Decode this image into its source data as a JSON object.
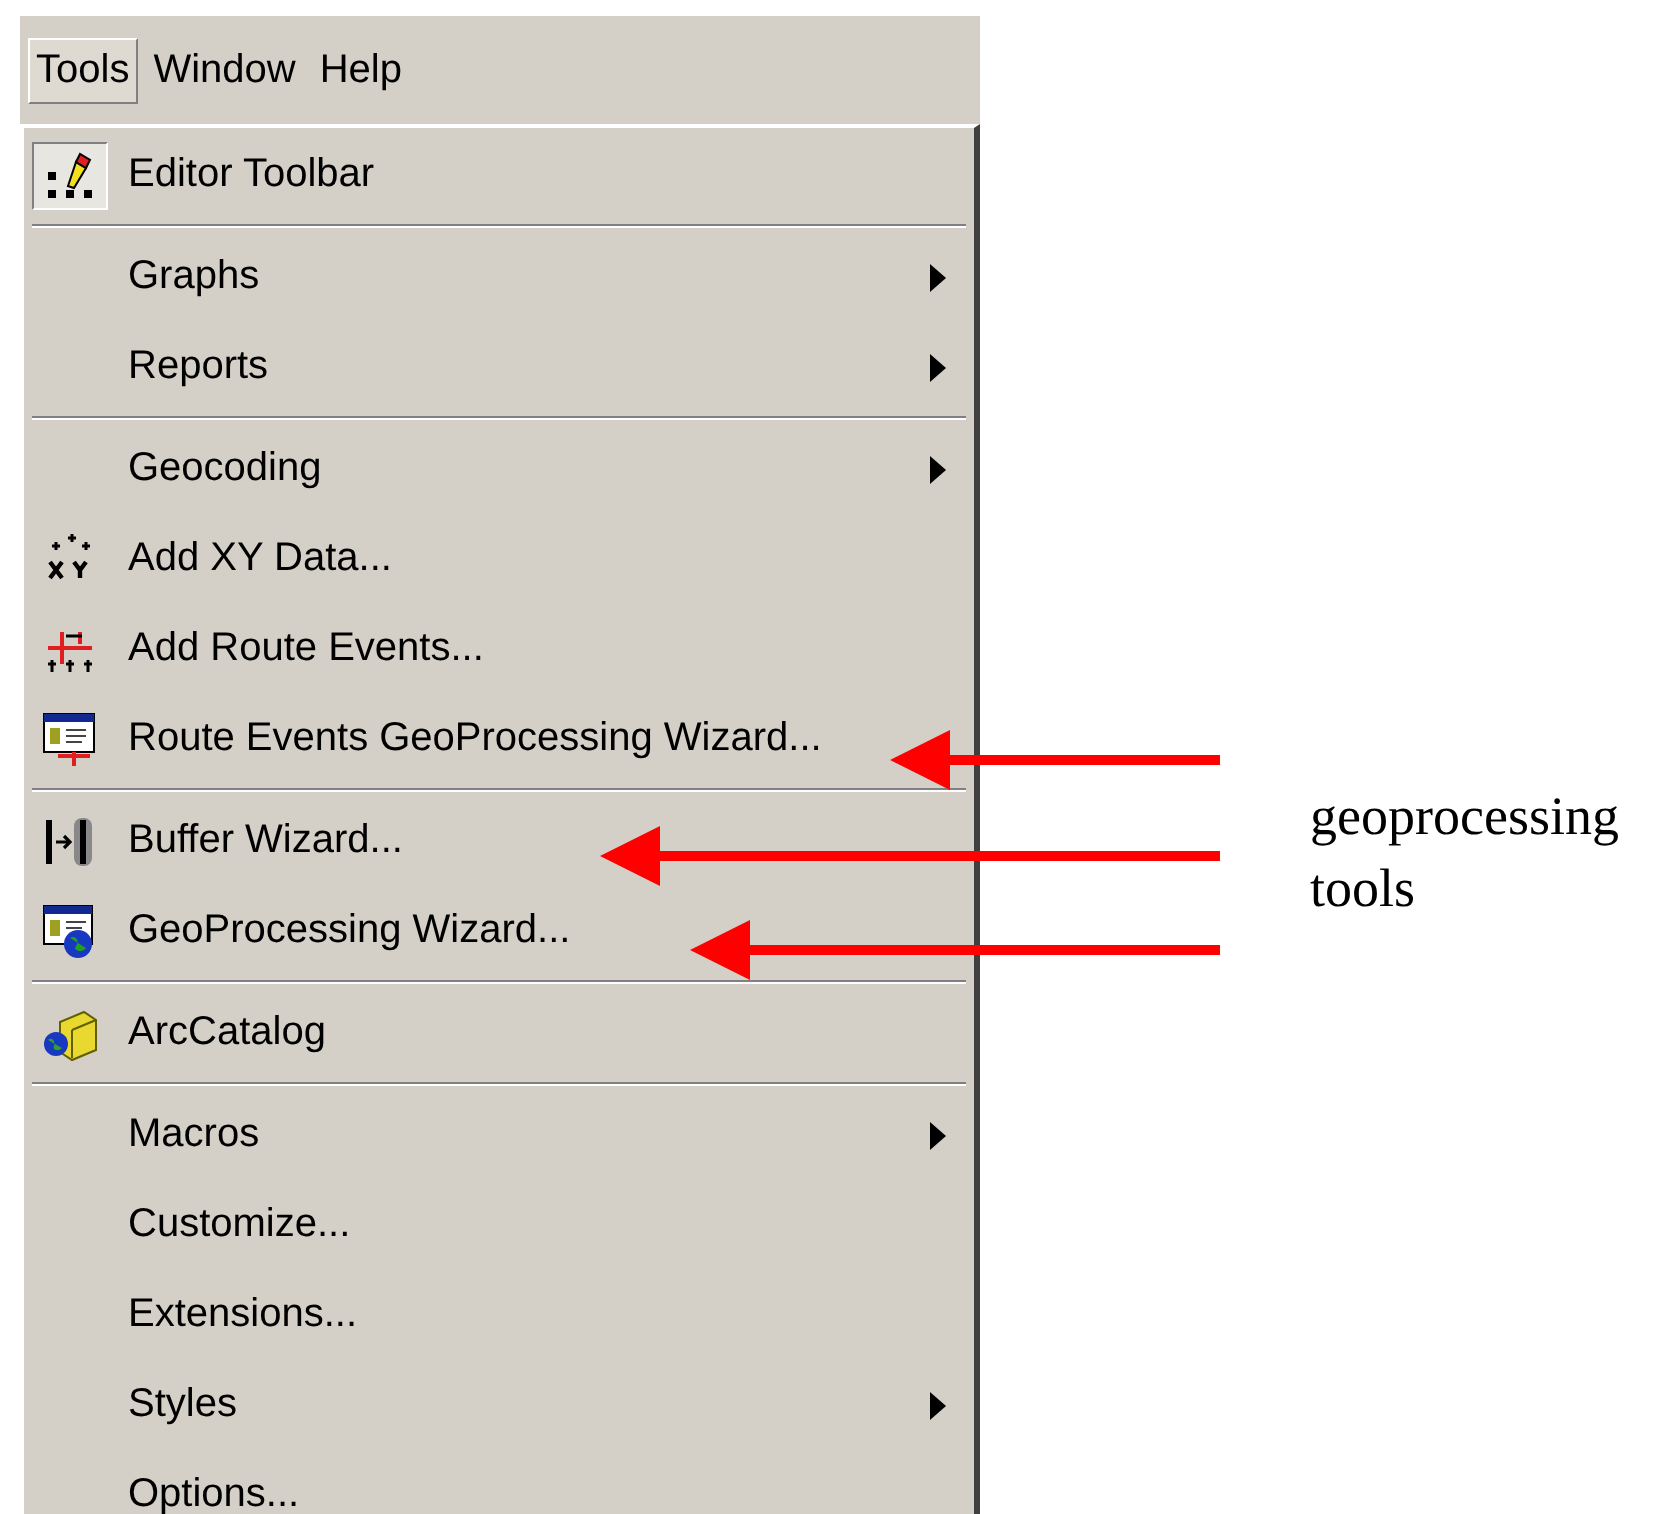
{
  "menu_bar": [
    {
      "label": "Tools",
      "selected": true
    },
    {
      "label": "Window",
      "selected": false
    },
    {
      "label": "Help",
      "selected": false
    }
  ],
  "menu": [
    {
      "kind": "item",
      "label": "Editor Toolbar",
      "checked": true,
      "submenu": false
    },
    {
      "kind": "separator"
    },
    {
      "kind": "item",
      "label": "Graphs",
      "checked": false,
      "submenu": true
    },
    {
      "kind": "item",
      "label": "Reports",
      "checked": false,
      "submenu": true
    },
    {
      "kind": "separator"
    },
    {
      "kind": "item",
      "label": "Geocoding",
      "checked": false,
      "submenu": true
    },
    {
      "kind": "item",
      "label": "Add XY Data...",
      "checked": false,
      "submenu": false
    },
    {
      "kind": "item",
      "label": "Add Route Events...",
      "checked": false,
      "submenu": false
    },
    {
      "kind": "item",
      "label": "Route Events GeoProcessing Wizard...",
      "checked": false,
      "submenu": false
    },
    {
      "kind": "separator"
    },
    {
      "kind": "item",
      "label": "Buffer Wizard...",
      "checked": false,
      "submenu": false
    },
    {
      "kind": "item",
      "label": "GeoProcessing Wizard...",
      "checked": false,
      "submenu": false
    },
    {
      "kind": "separator"
    },
    {
      "kind": "item",
      "label": "ArcCatalog",
      "checked": false,
      "submenu": false
    },
    {
      "kind": "separator"
    },
    {
      "kind": "item",
      "label": "Macros",
      "checked": false,
      "submenu": true
    },
    {
      "kind": "item",
      "label": "Customize...",
      "checked": false,
      "submenu": false
    },
    {
      "kind": "item",
      "label": "Extensions...",
      "checked": false,
      "submenu": false
    },
    {
      "kind": "item",
      "label": "Styles",
      "checked": false,
      "submenu": true
    },
    {
      "kind": "item",
      "label": "Options...",
      "checked": false,
      "submenu": false
    }
  ],
  "annotation": {
    "label": "geoprocessing tools"
  }
}
